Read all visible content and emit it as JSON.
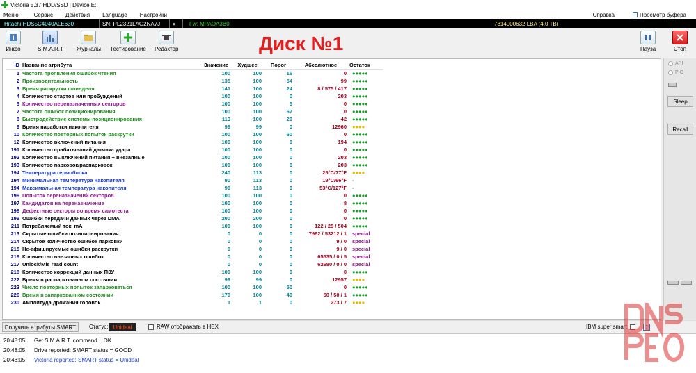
{
  "window": {
    "title": "Victoria 5.37 HDD/SSD | Device E:"
  },
  "menu": {
    "items": [
      "Меню",
      "Сервис",
      "Действия",
      "Language",
      "Настройки"
    ],
    "right": [
      "Справка",
      "Просмотр буфера"
    ]
  },
  "device": {
    "model": "Hitachi HDS5C4040ALE630",
    "sn": "SN: PL2321LAG2NA7J",
    "x": "x",
    "fw": "Fw: MPAOA3B0",
    "lba": "7814000632 LBA (4,0 TB)"
  },
  "toolbar": {
    "buttons": [
      "Инфо",
      "S.M.A.R.T",
      "Журналы",
      "Тестирование",
      "Редактор"
    ],
    "pause": "Пауза",
    "stop": "Стоп"
  },
  "title": "Диск №1",
  "table": {
    "headers": [
      "ID",
      "Название атрибута",
      "Значение",
      "Худшее",
      "Порог",
      "Абсолютное",
      "Остаток"
    ],
    "rows": [
      {
        "id": "1",
        "name": "Частота проявления ошибок чтения",
        "val": "100",
        "worst": "100",
        "thr": "16",
        "abs": "0",
        "ost": "●●●●●",
        "nc": "#1e8a1e",
        "oc": "dot5"
      },
      {
        "id": "2",
        "name": "Производительность",
        "val": "135",
        "worst": "100",
        "thr": "54",
        "abs": "99",
        "ost": "●●●●●",
        "nc": "#1e8a1e",
        "oc": "dot5"
      },
      {
        "id": "3",
        "name": "Время раскрутки шпинделя",
        "val": "141",
        "worst": "100",
        "thr": "24",
        "abs": "8 / 575 / 417",
        "ost": "●●●●●",
        "nc": "#1e8a1e",
        "oc": "dot5"
      },
      {
        "id": "4",
        "name": "Количество стартов или пробуждений",
        "val": "100",
        "worst": "100",
        "thr": "0",
        "abs": "203",
        "ost": "●●●●●",
        "nc": "#000",
        "oc": "dot5"
      },
      {
        "id": "5",
        "name": "Количество переназначенных секторов",
        "val": "100",
        "worst": "100",
        "thr": "5",
        "abs": "0",
        "ost": "●●●●●",
        "nc": "#8a1a8a",
        "oc": "dot5"
      },
      {
        "id": "7",
        "name": "Частота ошибок позиционирования",
        "val": "100",
        "worst": "100",
        "thr": "67",
        "abs": "0",
        "ost": "●●●●●",
        "nc": "#1e8a1e",
        "oc": "dot5"
      },
      {
        "id": "8",
        "name": "Быстродействие системы позиционирования",
        "val": "113",
        "worst": "100",
        "thr": "20",
        "abs": "42",
        "ost": "●●●●●",
        "nc": "#1e8a1e",
        "oc": "dot5"
      },
      {
        "id": "9",
        "name": "Время наработки накопителя",
        "val": "99",
        "worst": "99",
        "thr": "0",
        "abs": "12960",
        "ost": "●●●●",
        "nc": "#000",
        "oc": "dot4"
      },
      {
        "id": "10",
        "name": "Количество повторных попыток раскрутки",
        "val": "100",
        "worst": "100",
        "thr": "60",
        "abs": "0",
        "ost": "●●●●●",
        "nc": "#1e8a1e",
        "oc": "dot5"
      },
      {
        "id": "12",
        "name": "Количество включений питания",
        "val": "100",
        "worst": "100",
        "thr": "0",
        "abs": "194",
        "ost": "●●●●●",
        "nc": "#000",
        "oc": "dot5"
      },
      {
        "id": "191",
        "name": "Количество срабатываний датчика удара",
        "val": "100",
        "worst": "100",
        "thr": "0",
        "abs": "0",
        "ost": "●●●●●",
        "nc": "#000",
        "oc": "dot5"
      },
      {
        "id": "192",
        "name": "Количество выключений питания + внезапные",
        "val": "100",
        "worst": "100",
        "thr": "0",
        "abs": "203",
        "ost": "●●●●●",
        "nc": "#000",
        "oc": "dot5"
      },
      {
        "id": "193",
        "name": "Количество парковок/распарковок",
        "val": "100",
        "worst": "100",
        "thr": "0",
        "abs": "203",
        "ost": "●●●●●",
        "nc": "#000",
        "oc": "dot5"
      },
      {
        "id": "194",
        "name": "Температура гермоблока",
        "val": "240",
        "worst": "113",
        "thr": "0",
        "abs": "25°C/77°F",
        "ost": "●●●●",
        "nc": "#1a3cd0",
        "oc": "dot4"
      },
      {
        "id": "194",
        "name": "Минимальная температура накопителя",
        "val": "90",
        "worst": "113",
        "thr": "0",
        "abs": "19°C/66°F",
        "ost": "-",
        "nc": "#1a3cd0",
        "oc": "dash"
      },
      {
        "id": "194",
        "name": "Максимальная температура накопителя",
        "val": "90",
        "worst": "113",
        "thr": "0",
        "abs": "53°C/127°F",
        "ost": "-",
        "nc": "#1a3cd0",
        "oc": "dash"
      },
      {
        "id": "196",
        "name": "Попыток переназначений секторов",
        "val": "100",
        "worst": "100",
        "thr": "0",
        "abs": "0",
        "ost": "●●●●●",
        "nc": "#8a1a8a",
        "oc": "dot5"
      },
      {
        "id": "197",
        "name": "Кандидатов на переназначение",
        "val": "100",
        "worst": "100",
        "thr": "0",
        "abs": "8",
        "ost": "●●●●●",
        "nc": "#8a1a8a",
        "oc": "dot5"
      },
      {
        "id": "198",
        "name": "Дефектные секторы во время самотеста",
        "val": "100",
        "worst": "100",
        "thr": "0",
        "abs": "0",
        "ost": "●●●●●",
        "nc": "#8a1a8a",
        "oc": "dot5"
      },
      {
        "id": "199",
        "name": "Ошибки передачи данных через DMA",
        "val": "200",
        "worst": "200",
        "thr": "0",
        "abs": "0",
        "ost": "●●●●●",
        "nc": "#000",
        "oc": "dot5"
      },
      {
        "id": "211",
        "name": "Потребляемый ток, mA",
        "val": "100",
        "worst": "100",
        "thr": "0",
        "abs": "122 / 25 / 504",
        "ost": "●●●●●",
        "nc": "#000",
        "oc": "dot5"
      },
      {
        "id": "213",
        "name": "Скрытые ошибки позиционирования",
        "val": "0",
        "worst": "0",
        "thr": "0",
        "abs": "7962 / 53212 / 1",
        "ost": "special",
        "nc": "#000",
        "oc": "special"
      },
      {
        "id": "214",
        "name": "Скрытое количество ошибок парковки",
        "val": "0",
        "worst": "0",
        "thr": "0",
        "abs": "9 / 0",
        "ost": "special",
        "nc": "#000",
        "oc": "special"
      },
      {
        "id": "215",
        "name": "Не-афишируемые ошибки раскрутки",
        "val": "0",
        "worst": "0",
        "thr": "0",
        "abs": "9 / 0",
        "ost": "special",
        "nc": "#000",
        "oc": "special"
      },
      {
        "id": "216",
        "name": "Количество внезапных ошибок",
        "val": "0",
        "worst": "0",
        "thr": "0",
        "abs": "65535 / 0 / 5",
        "ost": "special",
        "nc": "#000",
        "oc": "special"
      },
      {
        "id": "217",
        "name": "Unlock/Mis read count",
        "val": "0",
        "worst": "0",
        "thr": "0",
        "abs": "62680 / 0 / 0",
        "ost": "special",
        "nc": "#000",
        "oc": "special"
      },
      {
        "id": "218",
        "name": "Количество коррекций данных ПЗУ",
        "val": "100",
        "worst": "100",
        "thr": "0",
        "abs": "0",
        "ost": "●●●●●",
        "nc": "#000",
        "oc": "dot5"
      },
      {
        "id": "222",
        "name": "Время в распаркованном состоянии",
        "val": "99",
        "worst": "99",
        "thr": "0",
        "abs": "12957",
        "ost": "●●●●",
        "nc": "#000",
        "oc": "dot4"
      },
      {
        "id": "223",
        "name": "Число повторных попыток запарковаться",
        "val": "100",
        "worst": "100",
        "thr": "50",
        "abs": "0",
        "ost": "●●●●●",
        "nc": "#1e8a1e",
        "oc": "dot5"
      },
      {
        "id": "226",
        "name": "Время в запаркованном состоянии",
        "val": "170",
        "worst": "100",
        "thr": "40",
        "abs": "50 / 50 / 1",
        "ost": "●●●●●",
        "nc": "#1e8a1e",
        "oc": "dot5"
      },
      {
        "id": "230",
        "name": "Амплитуда дрожания головок",
        "val": "1",
        "worst": "1",
        "thr": "0",
        "abs": "273 / 7",
        "ost": "●●●●",
        "nc": "#000",
        "oc": "dot4"
      }
    ]
  },
  "rightpanel": {
    "api": "API",
    "pio": "PIO",
    "sleep": "Sleep",
    "recall": "Recall"
  },
  "status": {
    "get_button": "Получить атрибуты SMART",
    "label": "Статус:",
    "value": "Unideal",
    "raw_hex": "RAW отображать в HEX",
    "ibm": "IBM super smart",
    "help": "?"
  },
  "log": [
    {
      "time": "20:48:05",
      "msg": "Get S.M.A.R.T. command... OK",
      "blue": false
    },
    {
      "time": "20:48:05",
      "msg": "Drive reported: SMART status = GOOD",
      "blue": false
    },
    {
      "time": "20:48:05",
      "msg": "Victoria reported: SMART status = Unideal",
      "blue": true
    }
  ],
  "watermark": {
    "text": [
      "DNS",
      "PEO"
    ],
    "color": "#d33"
  }
}
